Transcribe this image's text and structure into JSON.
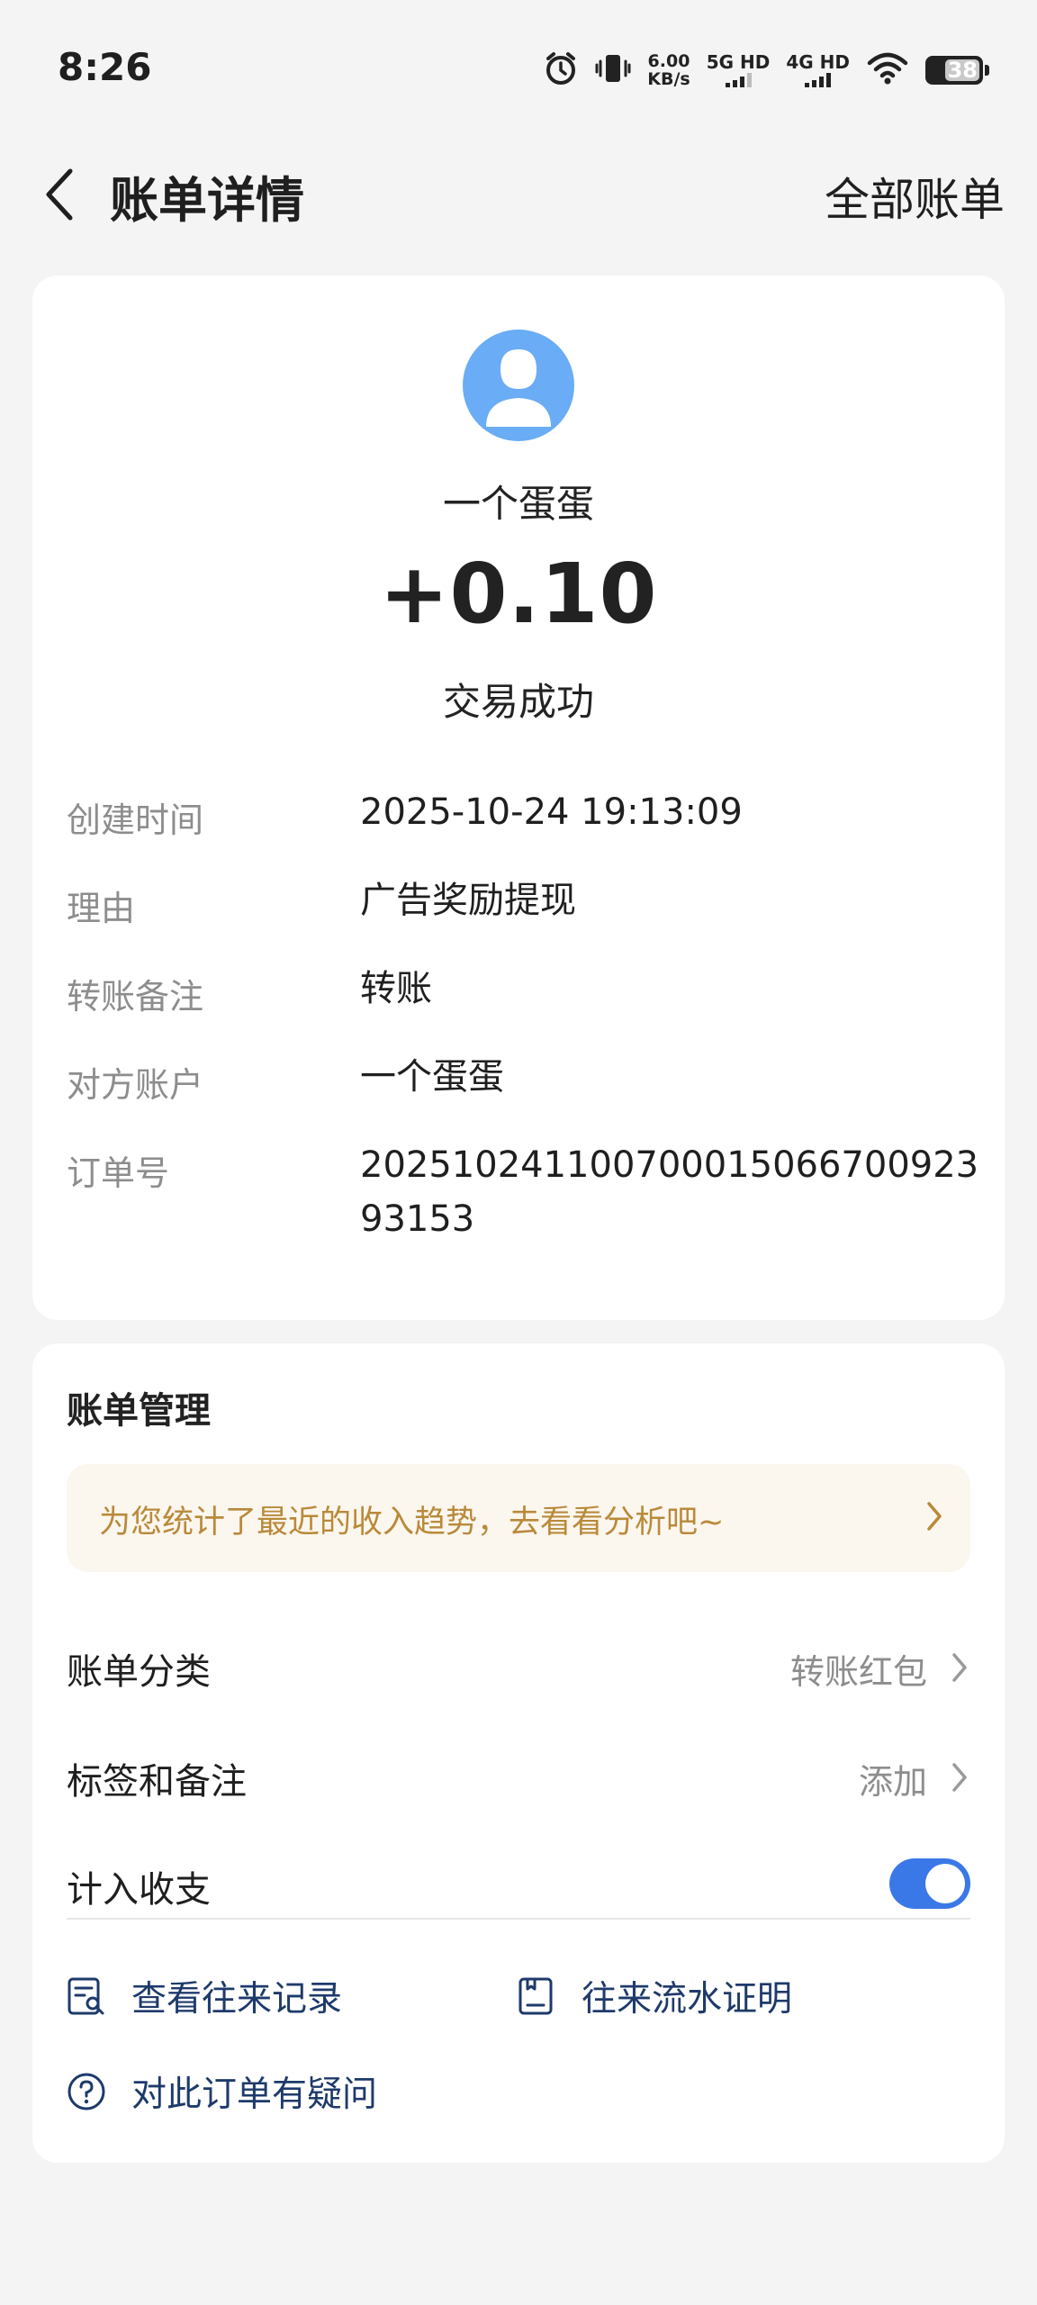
{
  "status_bar": {
    "time": "8:26",
    "net_speed_value": "6.00",
    "net_speed_unit": "KB/s",
    "net_5g": "5G HD",
    "net_4g": "4G HD",
    "battery": "38"
  },
  "header": {
    "title": "账单详情",
    "all_bills": "全部账单"
  },
  "transaction": {
    "payer_name": "一个蛋蛋",
    "amount": "+0.10",
    "status": "交易成功"
  },
  "details": [
    {
      "label": "创建时间",
      "value": "2025-10-24 19:13:09"
    },
    {
      "label": "理由",
      "value": "广告奖励提现"
    },
    {
      "label": "转账备注",
      "value": "转账"
    },
    {
      "label": "对方账户",
      "value": "一个蛋蛋"
    },
    {
      "label": "订单号",
      "value": "20251024110070001506670092393153"
    }
  ],
  "management": {
    "title": "账单管理",
    "insight": "为您统计了最近的收入趋势，去看看分析吧~",
    "category_label": "账单分类",
    "category_value": "转账红包",
    "tags_label": "标签和备注",
    "tags_value": "添加",
    "include_label": "计入收支",
    "include_enabled": true,
    "toggle_color": "#3b78e7"
  },
  "links": {
    "history": "查看往来记录",
    "proof": "往来流水证明",
    "question": "对此订单有疑问"
  },
  "colors": {
    "accent": "#3b78e7",
    "avatar": "#6aacf5",
    "insight_text": "#b98a3a",
    "link_text": "#1e3a6b"
  }
}
